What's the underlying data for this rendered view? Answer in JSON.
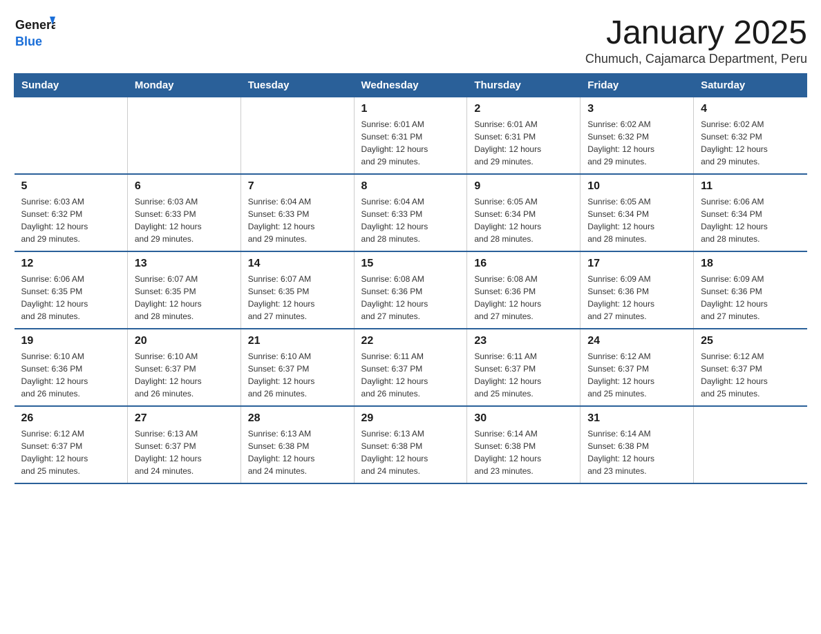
{
  "header": {
    "logo_general": "General",
    "logo_blue": "Blue",
    "month_title": "January 2025",
    "location": "Chumuch, Cajamarca Department, Peru"
  },
  "days_of_week": [
    "Sunday",
    "Monday",
    "Tuesday",
    "Wednesday",
    "Thursday",
    "Friday",
    "Saturday"
  ],
  "weeks": [
    [
      {
        "day": "",
        "info": ""
      },
      {
        "day": "",
        "info": ""
      },
      {
        "day": "",
        "info": ""
      },
      {
        "day": "1",
        "info": "Sunrise: 6:01 AM\nSunset: 6:31 PM\nDaylight: 12 hours\nand 29 minutes."
      },
      {
        "day": "2",
        "info": "Sunrise: 6:01 AM\nSunset: 6:31 PM\nDaylight: 12 hours\nand 29 minutes."
      },
      {
        "day": "3",
        "info": "Sunrise: 6:02 AM\nSunset: 6:32 PM\nDaylight: 12 hours\nand 29 minutes."
      },
      {
        "day": "4",
        "info": "Sunrise: 6:02 AM\nSunset: 6:32 PM\nDaylight: 12 hours\nand 29 minutes."
      }
    ],
    [
      {
        "day": "5",
        "info": "Sunrise: 6:03 AM\nSunset: 6:32 PM\nDaylight: 12 hours\nand 29 minutes."
      },
      {
        "day": "6",
        "info": "Sunrise: 6:03 AM\nSunset: 6:33 PM\nDaylight: 12 hours\nand 29 minutes."
      },
      {
        "day": "7",
        "info": "Sunrise: 6:04 AM\nSunset: 6:33 PM\nDaylight: 12 hours\nand 29 minutes."
      },
      {
        "day": "8",
        "info": "Sunrise: 6:04 AM\nSunset: 6:33 PM\nDaylight: 12 hours\nand 28 minutes."
      },
      {
        "day": "9",
        "info": "Sunrise: 6:05 AM\nSunset: 6:34 PM\nDaylight: 12 hours\nand 28 minutes."
      },
      {
        "day": "10",
        "info": "Sunrise: 6:05 AM\nSunset: 6:34 PM\nDaylight: 12 hours\nand 28 minutes."
      },
      {
        "day": "11",
        "info": "Sunrise: 6:06 AM\nSunset: 6:34 PM\nDaylight: 12 hours\nand 28 minutes."
      }
    ],
    [
      {
        "day": "12",
        "info": "Sunrise: 6:06 AM\nSunset: 6:35 PM\nDaylight: 12 hours\nand 28 minutes."
      },
      {
        "day": "13",
        "info": "Sunrise: 6:07 AM\nSunset: 6:35 PM\nDaylight: 12 hours\nand 28 minutes."
      },
      {
        "day": "14",
        "info": "Sunrise: 6:07 AM\nSunset: 6:35 PM\nDaylight: 12 hours\nand 27 minutes."
      },
      {
        "day": "15",
        "info": "Sunrise: 6:08 AM\nSunset: 6:36 PM\nDaylight: 12 hours\nand 27 minutes."
      },
      {
        "day": "16",
        "info": "Sunrise: 6:08 AM\nSunset: 6:36 PM\nDaylight: 12 hours\nand 27 minutes."
      },
      {
        "day": "17",
        "info": "Sunrise: 6:09 AM\nSunset: 6:36 PM\nDaylight: 12 hours\nand 27 minutes."
      },
      {
        "day": "18",
        "info": "Sunrise: 6:09 AM\nSunset: 6:36 PM\nDaylight: 12 hours\nand 27 minutes."
      }
    ],
    [
      {
        "day": "19",
        "info": "Sunrise: 6:10 AM\nSunset: 6:36 PM\nDaylight: 12 hours\nand 26 minutes."
      },
      {
        "day": "20",
        "info": "Sunrise: 6:10 AM\nSunset: 6:37 PM\nDaylight: 12 hours\nand 26 minutes."
      },
      {
        "day": "21",
        "info": "Sunrise: 6:10 AM\nSunset: 6:37 PM\nDaylight: 12 hours\nand 26 minutes."
      },
      {
        "day": "22",
        "info": "Sunrise: 6:11 AM\nSunset: 6:37 PM\nDaylight: 12 hours\nand 26 minutes."
      },
      {
        "day": "23",
        "info": "Sunrise: 6:11 AM\nSunset: 6:37 PM\nDaylight: 12 hours\nand 25 minutes."
      },
      {
        "day": "24",
        "info": "Sunrise: 6:12 AM\nSunset: 6:37 PM\nDaylight: 12 hours\nand 25 minutes."
      },
      {
        "day": "25",
        "info": "Sunrise: 6:12 AM\nSunset: 6:37 PM\nDaylight: 12 hours\nand 25 minutes."
      }
    ],
    [
      {
        "day": "26",
        "info": "Sunrise: 6:12 AM\nSunset: 6:37 PM\nDaylight: 12 hours\nand 25 minutes."
      },
      {
        "day": "27",
        "info": "Sunrise: 6:13 AM\nSunset: 6:37 PM\nDaylight: 12 hours\nand 24 minutes."
      },
      {
        "day": "28",
        "info": "Sunrise: 6:13 AM\nSunset: 6:38 PM\nDaylight: 12 hours\nand 24 minutes."
      },
      {
        "day": "29",
        "info": "Sunrise: 6:13 AM\nSunset: 6:38 PM\nDaylight: 12 hours\nand 24 minutes."
      },
      {
        "day": "30",
        "info": "Sunrise: 6:14 AM\nSunset: 6:38 PM\nDaylight: 12 hours\nand 23 minutes."
      },
      {
        "day": "31",
        "info": "Sunrise: 6:14 AM\nSunset: 6:38 PM\nDaylight: 12 hours\nand 23 minutes."
      },
      {
        "day": "",
        "info": ""
      }
    ]
  ]
}
